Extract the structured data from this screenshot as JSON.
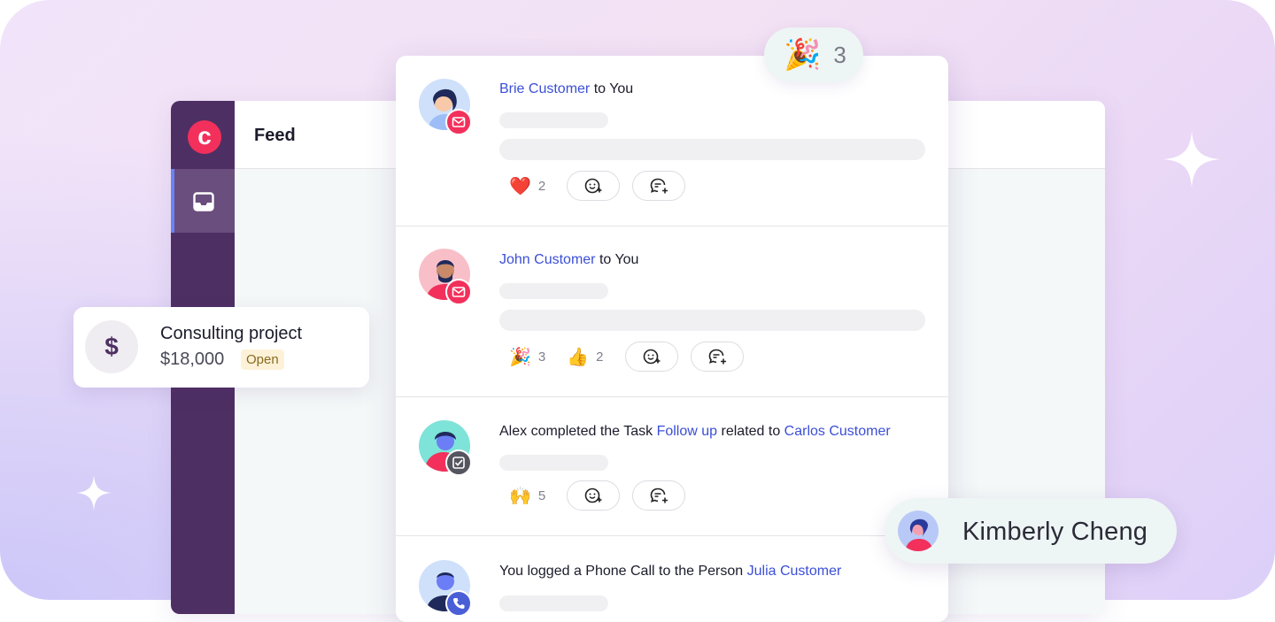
{
  "app": {
    "title": "Feed",
    "logo": "c",
    "nav_active_icon": "inbox-icon",
    "colors": {
      "sidebar": "#4e2f63",
      "accent": "#f2305b",
      "link": "#3b4fd6"
    }
  },
  "deal_card": {
    "icon": "$",
    "title": "Consulting project",
    "amount": "$18,000",
    "status": "Open"
  },
  "party_bubble": {
    "emoji": "🎉",
    "count": "3"
  },
  "feed": {
    "items": [
      {
        "author": "Brie Customer",
        "connector": " to ",
        "target": "You",
        "badge_icon": "mail-icon",
        "reactions": [
          {
            "emoji": "❤️",
            "count": "2"
          }
        ]
      },
      {
        "author": "John Customer",
        "connector": " to ",
        "target": "You",
        "badge_icon": "mail-icon",
        "reactions": [
          {
            "emoji": "🎉",
            "count": "3"
          },
          {
            "emoji": "👍",
            "count": "2"
          }
        ]
      },
      {
        "part1": "Alex completed the Task ",
        "link1": "Follow up",
        "part2": " related to ",
        "link2": "Carlos Customer",
        "badge_icon": "task-check-icon",
        "reactions": [
          {
            "emoji": "🙌",
            "count": "5"
          }
        ]
      },
      {
        "part1": "You logged a Phone Call to the Person ",
        "link1": "Julia Customer",
        "badge_icon": "phone-icon"
      }
    ]
  },
  "user_chip": {
    "name": "Kimberly Cheng"
  }
}
